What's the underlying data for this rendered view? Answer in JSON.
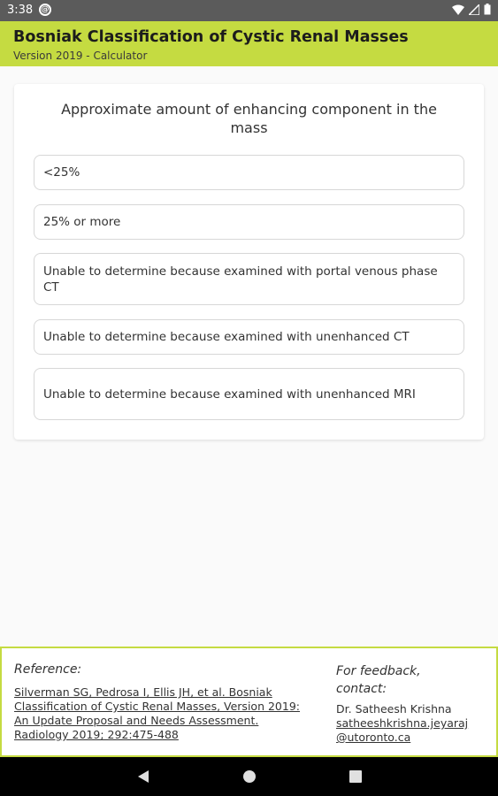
{
  "status_bar": {
    "time": "3:38",
    "notification_icon_label": "@"
  },
  "app_bar": {
    "title": "Bosniak Classification of Cystic Renal Masses",
    "subtitle": "Version 2019 - Calculator",
    "color": "#c5db41"
  },
  "question": {
    "text": "Approximate amount of enhancing component in the mass",
    "options": [
      {
        "label": "<25%"
      },
      {
        "label": "25% or more"
      },
      {
        "label": "Unable to determine because examined with portal venous phase CT"
      },
      {
        "label": "Unable to determine because examined with unenhanced CT"
      },
      {
        "label": "Unable to determine because examined with unenhanced MRI"
      }
    ]
  },
  "footer": {
    "reference_label": "Reference:",
    "reference_link": "Silverman SG, Pedrosa I, Ellis JH, et al. Bosniak Classification of Cystic Renal Masses, Version 2019: An Update Proposal and Needs Assessment. Radiology 2019; 292:475-488",
    "feedback_label": "For feedback, contact:",
    "contact_name": "Dr. Satheesh Krishna",
    "contact_email": "satheeshkrishna.jeyaraj@utoronto.ca"
  },
  "nav_bar": {
    "icons": [
      "back-icon",
      "home-icon",
      "recents-icon"
    ]
  }
}
